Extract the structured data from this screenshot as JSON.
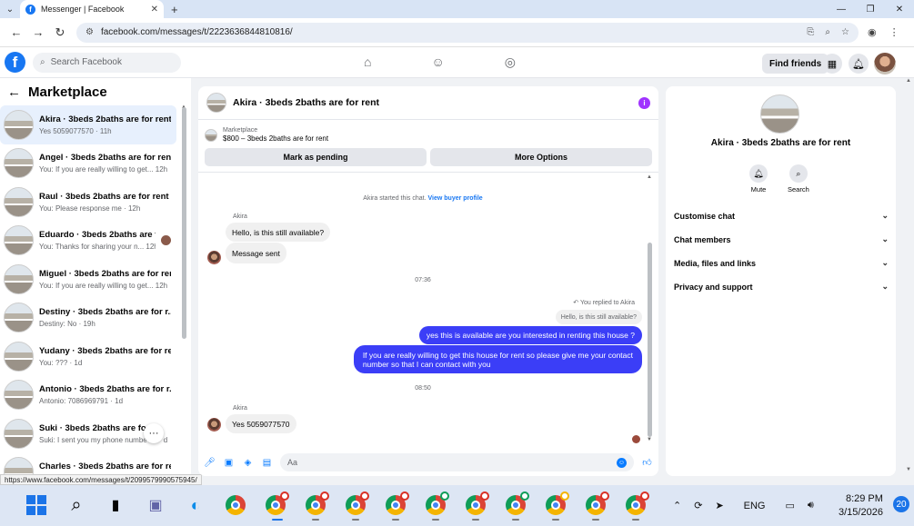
{
  "browser": {
    "tab_title": "Messenger | Facebook",
    "tab_close": "✕",
    "new_tab": "+",
    "url": "facebook.com/messages/t/2223636844810816/",
    "status_url": "https://www.facebook.com/messages/t/2099579990575945/"
  },
  "fb": {
    "search_placeholder": "Search Facebook",
    "find_friends": "Find friends"
  },
  "sidebar": {
    "title": "Marketplace",
    "conversations": [
      {
        "title": "Akira · 3beds 2baths are for rent",
        "sub": "Yes 5059077570 · 11h",
        "active": true
      },
      {
        "title": "Angel · 3beds 2baths are for rent",
        "sub": "You: If you are really willing to get...  12h"
      },
      {
        "title": "Raul · 3beds 2baths are for rent",
        "sub": "You: Please response me · 12h"
      },
      {
        "title": "Eduardo · 3beds 2baths are fo...",
        "sub": "You: Thanks for sharing your n...  12h"
      },
      {
        "title": "Miguel · 3beds 2baths are for rent",
        "sub": "You: If you are really willing to get...  12h"
      },
      {
        "title": "Destiny · 3beds 2baths are for r...",
        "sub": "Destiny: No · 19h"
      },
      {
        "title": "Yudany · 3beds 2baths are for re...",
        "sub": "You: ??? · 1d"
      },
      {
        "title": "Antonio · 3beds 2baths are for r...",
        "sub": "Antonio: 7086969791 · 1d"
      },
      {
        "title": "Suki · 3beds 2baths are for r",
        "sub": "Suki: I sent you my phone numbe",
        "suffix": "d"
      },
      {
        "title": "Charles · 3beds 2baths are for re...",
        "sub": "Charles: 7189610056 · 1d"
      }
    ],
    "more_label": "···"
  },
  "chat": {
    "title": "Akira · 3beds 2baths are for rent",
    "marketplace_label": "Marketplace",
    "listing": "$800 – 3beds 2baths are for rent",
    "btn_pending": "Mark as pending",
    "btn_more": "More Options",
    "started_text": "Akira started this chat.",
    "view_profile": "View buyer profile",
    "sender_name": "Akira",
    "msg1": "Hello, is this still available?",
    "msg2": "Message sent",
    "time1": "07:36",
    "replied_label": "You replied to Akira",
    "quoted": "Hello, is this still available?",
    "out1": "yes this is available are you interested in renting this house ?",
    "out2_line1": "If you are really willing to get this house for rent so please give me your contact",
    "out2_line2": "number so that I can contact with you",
    "time2": "08:50",
    "sender_name2": "Akira",
    "msg3": "Yes 5059077570",
    "composer_placeholder": "Aa"
  },
  "details": {
    "title": "Akira · 3beds 2baths are for rent",
    "mute": "Mute",
    "search": "Search",
    "items": [
      "Customise chat",
      "Chat members",
      "Media, files and links",
      "Privacy and support"
    ]
  },
  "taskbar": {
    "lang": "ENG",
    "time": "8:29 PM",
    "date": "3/15/2026",
    "notif": "20"
  },
  "icons": {
    "back": "arrow-left-icon",
    "forward": "arrow-right-icon",
    "reload": "reload-icon",
    "home": "home-icon",
    "friends": "friends-icon",
    "groups": "groups-icon",
    "menu": "grid-icon",
    "bell": "bell-icon",
    "info": "info-icon",
    "mic": "mic-icon",
    "image": "image-icon",
    "sticker": "sticker-icon",
    "gif": "gif-icon",
    "emoji": "emoji-icon",
    "like": "thumbs-up-icon"
  },
  "colors": {
    "fb_blue": "#1877f2",
    "outgoing_bubble": "#3b3ef7",
    "active_conv": "#e7f0fd",
    "info_purple": "#a033ff"
  }
}
